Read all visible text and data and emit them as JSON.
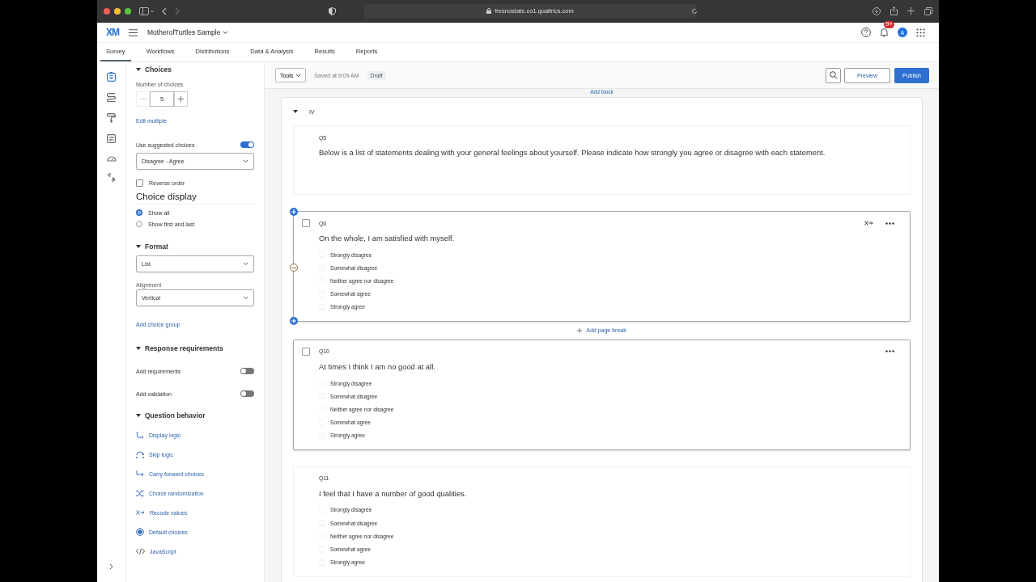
{
  "browser": {
    "url": "fresnostate.co1.qualtrics.com"
  },
  "header": {
    "logo": "XM",
    "project": "MotherofTurtles Sample",
    "notification_badge": "9+",
    "avatar": "A"
  },
  "tabs": [
    {
      "label": "Survey",
      "selected": true
    },
    {
      "label": "Workflows",
      "selected": false
    },
    {
      "label": "Distributions",
      "selected": false
    },
    {
      "label": "Data & Analysis",
      "selected": false
    },
    {
      "label": "Results",
      "selected": false
    },
    {
      "label": "Reports",
      "selected": false
    }
  ],
  "rail": [
    {
      "selected": true
    },
    {
      "selected": false
    },
    {
      "selected": false
    },
    {
      "selected": false
    },
    {
      "selected": false
    },
    {
      "selected": false
    }
  ],
  "panel": {
    "choices": {
      "title": "Choices",
      "expanded": true,
      "count_label": "Number of choices",
      "count": "5",
      "edit_link": "Edit multiple",
      "suggested": {
        "label": "Use suggested choices",
        "on": true
      },
      "suggested_value": "Disagree - Agree",
      "reverse": {
        "label": "Reverse order",
        "checked": false
      },
      "display_heading": "Choice display",
      "display_options": [
        {
          "label": "Show all",
          "selected": true
        },
        {
          "label": "Show first and last",
          "selected": false
        }
      ]
    },
    "format": {
      "title": "Format",
      "expanded": true,
      "format_value": "List",
      "alignment_label": "Alignment",
      "alignment_value": "Vertical",
      "group_link": "Add choice group"
    },
    "requirements": {
      "title": "Response requirements",
      "expanded": true,
      "toggles": [
        {
          "label": "Add requirements",
          "on": false
        },
        {
          "label": "Add validation",
          "on": false
        }
      ]
    },
    "behavior": {
      "title": "Question behavior",
      "expanded": true,
      "links": [
        "Display logic",
        "Skip logic",
        "Carry forward choices",
        "Choice randomization",
        "Recode values",
        "Default choices",
        "JavaScript"
      ]
    }
  },
  "toolbar": {
    "tools": "Tools",
    "saved": "Saved at 9:09 AM",
    "status": "Draft",
    "preview": "Preview",
    "publish": "Publish"
  },
  "survey": {
    "add_block": "Add block",
    "block": {
      "name": "IV",
      "expanded": true,
      "questions": [
        {
          "id": "Q5",
          "text": "Below is a list of statements dealing with your general feelings about yourself. Please indicate how strongly you agree or disagree with each statement.",
          "selected": false,
          "focused": false
        },
        {
          "id": "Q6",
          "text": "On the whole, I am satisfied with myself.",
          "selected": true,
          "focused": true,
          "choices": [
            "Strongly disagree",
            "Somewhat disagree",
            "Neither agree nor disagree",
            "Somewhat agree",
            "Strongly agree"
          ],
          "page_break_after": "Add page break"
        },
        {
          "id": "Q10",
          "text": "At times I think I am no good at all.",
          "selected": true,
          "focused": false,
          "choices": [
            "Strongly disagree",
            "Somewhat disagree",
            "Neither agree nor disagree",
            "Somewhat agree",
            "Strongly agree"
          ]
        },
        {
          "id": "Q11",
          "text": "I feel that I have a number of good qualities.",
          "selected": false,
          "focused": false,
          "choices": [
            "Strongly disagree",
            "Somewhat disagree",
            "Neither agree nor disagree",
            "Somewhat agree",
            "Strongly agree"
          ]
        }
      ]
    }
  }
}
